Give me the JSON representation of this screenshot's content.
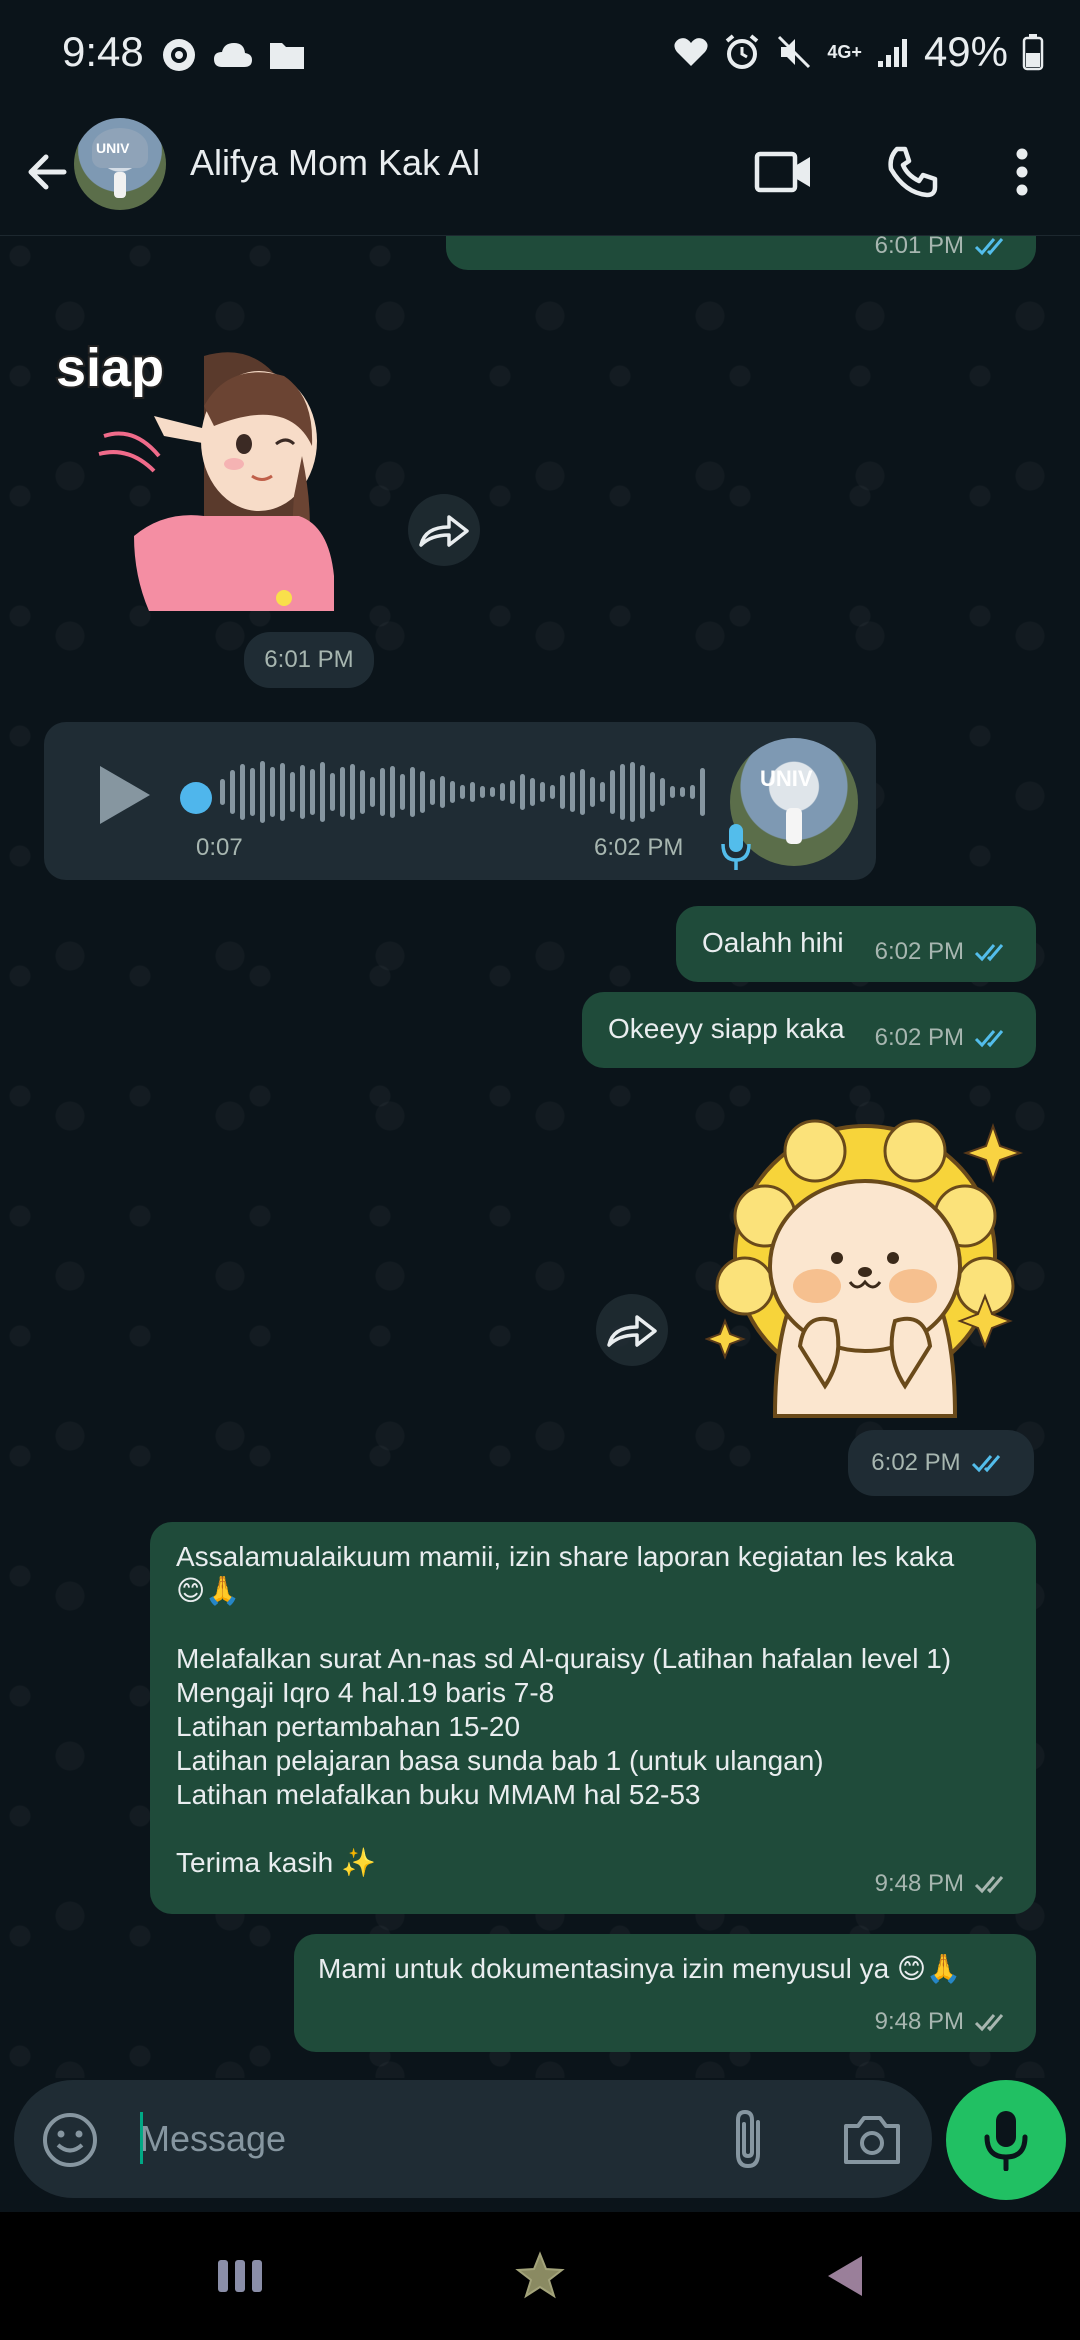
{
  "status_bar": {
    "time": "9:48",
    "network": "4G+",
    "battery": "49%"
  },
  "header": {
    "contact_name": "Alifya Mom Kak Al",
    "avatar_text": "UNIV"
  },
  "messages": {
    "top_partial_time": "6:01 PM",
    "sticker_girl": {
      "label": "siap",
      "time": "6:01 PM"
    },
    "voice_note": {
      "duration": "0:07",
      "time": "6:02 PM",
      "avatar_text": "UNIV"
    },
    "m1": {
      "text": "Oalahh hihi",
      "time": "6:02 PM"
    },
    "m2": {
      "text": "Okeeyy siapp kaka",
      "time": "6:02 PM"
    },
    "sticker_sun": {
      "time": "6:02 PM"
    },
    "m3": {
      "text": "Assalamualaikuum mamii, izin share laporan kegiatan les kaka\n😊🙏\n\nMelafalkan surat An-nas sd Al-quraisy (Latihan hafalan level 1)\nMengaji Iqro 4 hal.19 baris 7-8\nLatihan pertambahan 15-20\nLatihan pelajaran basa sunda bab 1 (untuk ulangan)\nLatihan melafalkan buku MMAM hal 52-53\n\nTerima kasih ✨",
      "time": "9:48 PM"
    },
    "m4": {
      "text": "Mami untuk dokumentasinya izin menyusul ya 😊🙏",
      "time": "9:48 PM"
    }
  },
  "input": {
    "placeholder": "Message"
  },
  "colors": {
    "bg": "#0b141a",
    "outgoing": "#1f4b3a",
    "incoming": "#1f2c34",
    "accent": "#21c063",
    "tick_read": "#53bdeb"
  },
  "icons": [
    "back-arrow-icon",
    "video-call-icon",
    "phone-icon",
    "more-icon",
    "forward-icon",
    "play-icon",
    "mic-icon",
    "emoji-icon",
    "attach-icon",
    "camera-icon"
  ]
}
